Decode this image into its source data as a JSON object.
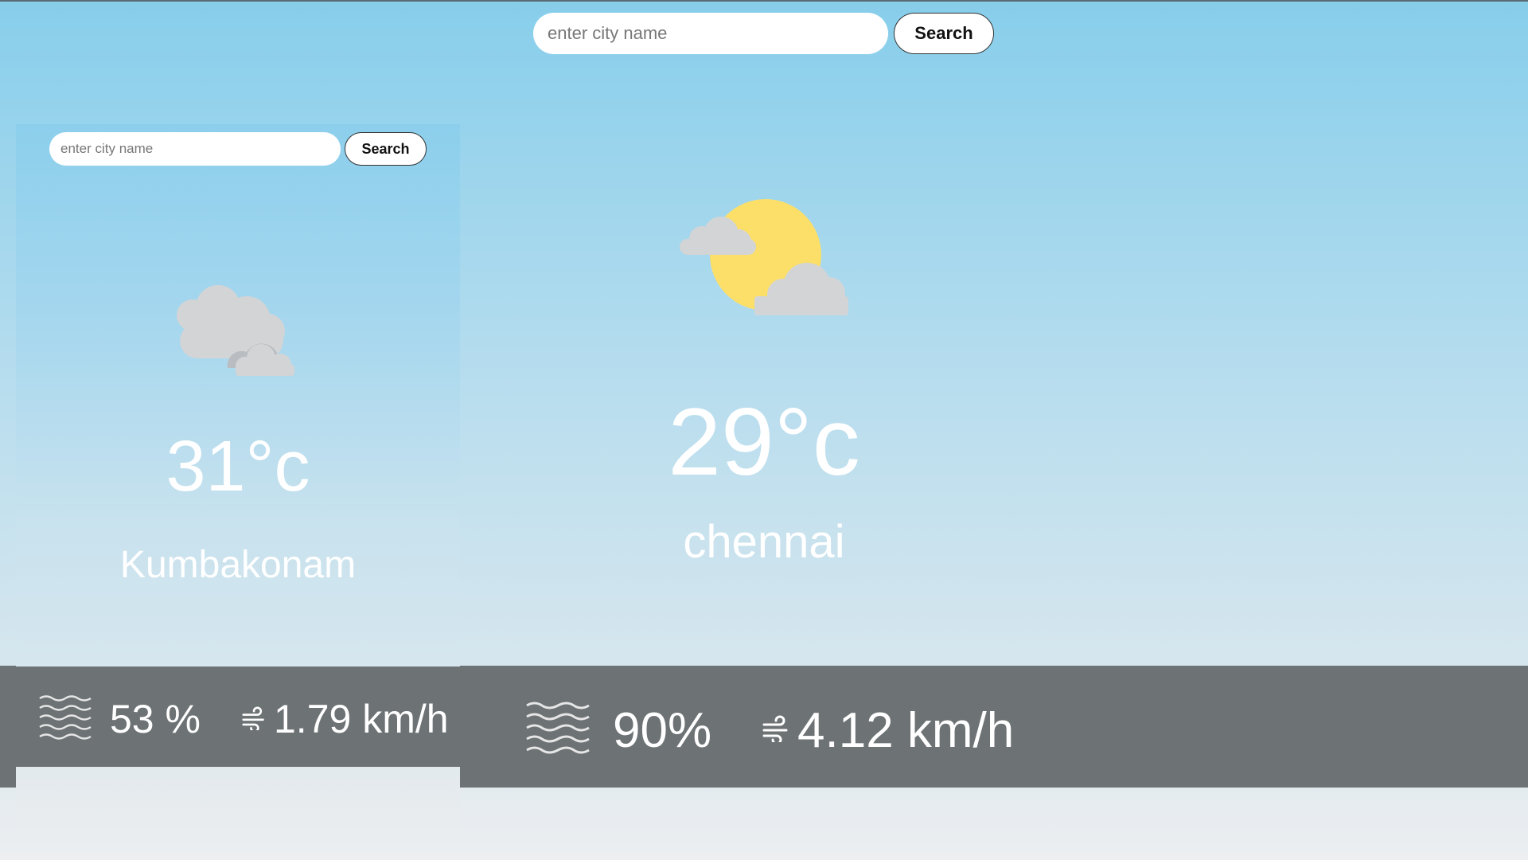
{
  "main": {
    "search": {
      "placeholder": "enter city name",
      "value": "",
      "button_label": "Search"
    },
    "weather": {
      "icon": "partly-cloudy-sun-icon",
      "temperature": "29°c",
      "city": "chennai"
    },
    "stats": {
      "humidity": "90%",
      "wind": "4.12 km/h"
    }
  },
  "card": {
    "search": {
      "placeholder": "enter city name",
      "value": "",
      "button_label": "Search"
    },
    "weather": {
      "icon": "clouds-icon",
      "temperature": "31°c",
      "city": "Kumbakonam"
    },
    "stats": {
      "humidity": "53 %",
      "wind": "1.79 km/h"
    }
  },
  "colors": {
    "sky_top": "#87ceeb",
    "bar": "#6d7275",
    "sun": "#fcdf69",
    "cloud": "#d3d4d6",
    "text": "#ffffff"
  }
}
